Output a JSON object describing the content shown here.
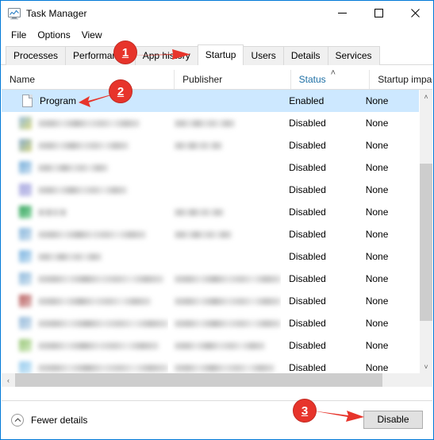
{
  "window": {
    "title": "Task Manager",
    "icon": "task-manager-icon",
    "accent": "#0078d7",
    "controls": [
      {
        "name": "minimize",
        "glyph": "─"
      },
      {
        "name": "maximize",
        "glyph": "□"
      },
      {
        "name": "close",
        "glyph": "✕"
      }
    ]
  },
  "menubar": {
    "items": [
      {
        "label": "File"
      },
      {
        "label": "Options"
      },
      {
        "label": "View"
      }
    ]
  },
  "tabs": {
    "active": "Startup",
    "items": [
      {
        "label": "Processes",
        "active": false
      },
      {
        "label": "Performance",
        "active": false
      },
      {
        "label": "App history",
        "active": false
      },
      {
        "label": "Startup",
        "active": true
      },
      {
        "label": "Users",
        "active": false
      },
      {
        "label": "Details",
        "active": false
      },
      {
        "label": "Services",
        "active": false
      }
    ]
  },
  "table": {
    "columns": [
      {
        "label": "Name",
        "sorted": false
      },
      {
        "label": "Publisher",
        "sorted": false
      },
      {
        "label": "Status",
        "sorted": true,
        "sort_direction": "ascending",
        "sort_glyph": "˄"
      },
      {
        "label": "Startup impac",
        "sorted": false
      }
    ],
    "rows": [
      {
        "name": "Program",
        "publisher": "",
        "status": "Enabled",
        "impact": "None",
        "selected": true,
        "redacted": false,
        "icon": "file-icon"
      },
      {
        "name": "",
        "publisher": "",
        "status": "Disabled",
        "impact": "None",
        "selected": false,
        "redacted": true,
        "icon_color": "#8fb8da",
        "icon_color2": "#d9d87a",
        "name_width": 128,
        "pub_width": 76
      },
      {
        "name": "",
        "publisher": "",
        "status": "Disabled",
        "impact": "None",
        "selected": false,
        "redacted": true,
        "icon_color": "#7ba4c8",
        "icon_color2": "#d3d37b",
        "name_width": 114,
        "pub_width": 60
      },
      {
        "name": "",
        "publisher": "",
        "status": "Disabled",
        "impact": "None",
        "selected": false,
        "redacted": true,
        "icon_color": "#66a5d6",
        "icon_color2": "#cfe2f2",
        "name_width": 88,
        "pub_width": 0
      },
      {
        "name": "",
        "publisher": "",
        "status": "Disabled",
        "impact": "None",
        "selected": false,
        "redacted": true,
        "icon_color": "#a8a8e0",
        "icon_color2": "#c3c3ea",
        "name_width": 112,
        "pub_width": 0
      },
      {
        "name": "",
        "publisher": "",
        "status": "Disabled",
        "impact": "None",
        "selected": false,
        "redacted": true,
        "icon_color": "#1f9a4d",
        "icon_color2": "#8fd8a6",
        "name_width": 36,
        "pub_width": 62
      },
      {
        "name": "",
        "publisher": "",
        "status": "Disabled",
        "impact": "None",
        "selected": false,
        "redacted": true,
        "icon_color": "#7bb0da",
        "icon_color2": "#cfe0ee",
        "name_width": 136,
        "pub_width": 72
      },
      {
        "name": "",
        "publisher": "",
        "status": "Disabled",
        "impact": "None",
        "selected": false,
        "redacted": true,
        "icon_color": "#6aabdd",
        "icon_color2": "#cfe4f4",
        "name_width": 80,
        "pub_width": 0
      },
      {
        "name": "",
        "publisher": "",
        "status": "Disabled",
        "impact": "None",
        "selected": false,
        "redacted": true,
        "icon_color": "#84b4da",
        "icon_color2": "#d2e3f0",
        "name_width": 158,
        "pub_width": 140
      },
      {
        "name": "",
        "publisher": "",
        "status": "Disabled",
        "impact": "None",
        "selected": false,
        "redacted": true,
        "icon_color": "#b35050",
        "icon_color2": "#e0bdbd",
        "name_width": 142,
        "pub_width": 136
      },
      {
        "name": "",
        "publisher": "",
        "status": "Disabled",
        "impact": "None",
        "selected": false,
        "redacted": true,
        "icon_color": "#8ab3d8",
        "icon_color2": "#d4e3ef",
        "name_width": 182,
        "pub_width": 140
      },
      {
        "name": "",
        "publisher": "",
        "status": "Disabled",
        "impact": "None",
        "selected": false,
        "redacted": true,
        "icon_color": "#8dc06a",
        "icon_color2": "#d6ecc4",
        "name_width": 152,
        "pub_width": 114
      },
      {
        "name": "",
        "publisher": "",
        "status": "Disabled",
        "impact": "None",
        "selected": false,
        "redacted": true,
        "icon_color": "#8ec7ec",
        "icon_color2": "#cfe9f8",
        "name_width": 180,
        "pub_width": 126
      }
    ]
  },
  "scrollbars": {
    "vertical": {
      "up_glyph": "˄",
      "down_glyph": "˅"
    },
    "horizontal": {
      "left_glyph": "‹",
      "right_glyph": "›"
    }
  },
  "footer": {
    "fewer_details_label": "Fewer details",
    "fewer_details_icon": "chevron-up-circle-icon",
    "disable_button_label": "Disable"
  },
  "annotations": {
    "marker_color": "#e7342b",
    "items": [
      {
        "number": "1",
        "points_to": "Startup tab",
        "direction": "right"
      },
      {
        "number": "2",
        "points_to": "Program row",
        "direction": "left"
      },
      {
        "number": "3",
        "points_to": "Disable button",
        "direction": "right"
      }
    ]
  }
}
